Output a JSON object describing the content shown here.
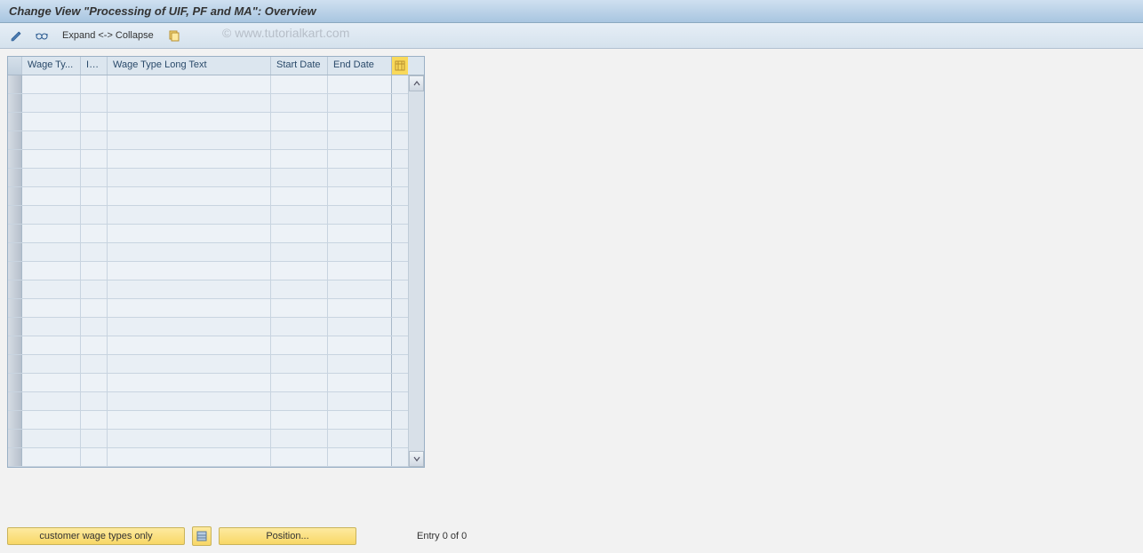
{
  "title": "Change View \"Processing of UIF, PF and MA\": Overview",
  "toolbar": {
    "expand_collapse": "Expand <-> Collapse"
  },
  "watermark": "© www.tutorialkart.com",
  "table": {
    "columns": {
      "wage_type": "Wage Ty...",
      "inf": "Inf...",
      "long_text": "Wage Type Long Text",
      "start_date": "Start Date",
      "end_date": "End Date"
    },
    "row_count": 21
  },
  "footer": {
    "customer_btn": "customer wage types only",
    "position_btn": "Position...",
    "entry_status": "Entry 0 of 0"
  }
}
